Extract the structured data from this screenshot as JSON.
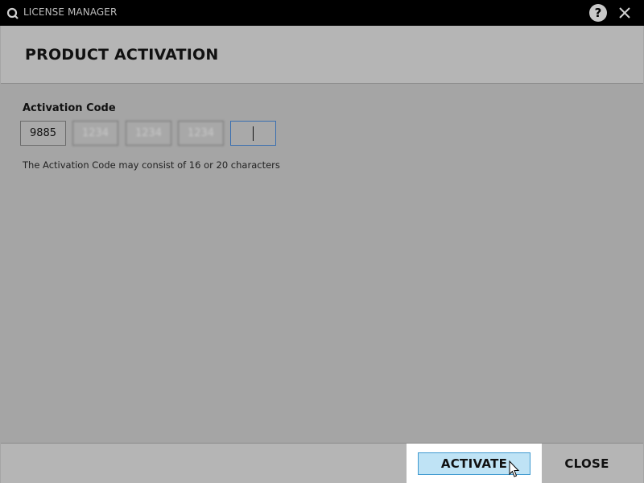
{
  "window": {
    "title": "LICENSE MANAGER",
    "app_icon": "q-logo-icon",
    "help_label": "?",
    "close_icon": "close-icon"
  },
  "header": {
    "title": "PRODUCT ACTIVATION"
  },
  "form": {
    "label": "Activation Code",
    "fields": [
      {
        "value": "9885",
        "state": "filled"
      },
      {
        "value": "1234",
        "state": "blurred"
      },
      {
        "value": "1234",
        "state": "blurred"
      },
      {
        "value": "1234",
        "state": "blurred"
      },
      {
        "value": "",
        "state": "focused"
      }
    ],
    "hint": "The Activation Code may consist of 16 or 20 characters"
  },
  "footer": {
    "activate_label": "ACTIVATE",
    "close_label": "CLOSE"
  },
  "colors": {
    "titlebar": "#000000",
    "body": "#a5a5a5",
    "header": "#b5b5b5",
    "activate_bg": "#bfe3f5",
    "activate_border": "#3f9ad0",
    "focus_border": "#3a6fb0"
  }
}
